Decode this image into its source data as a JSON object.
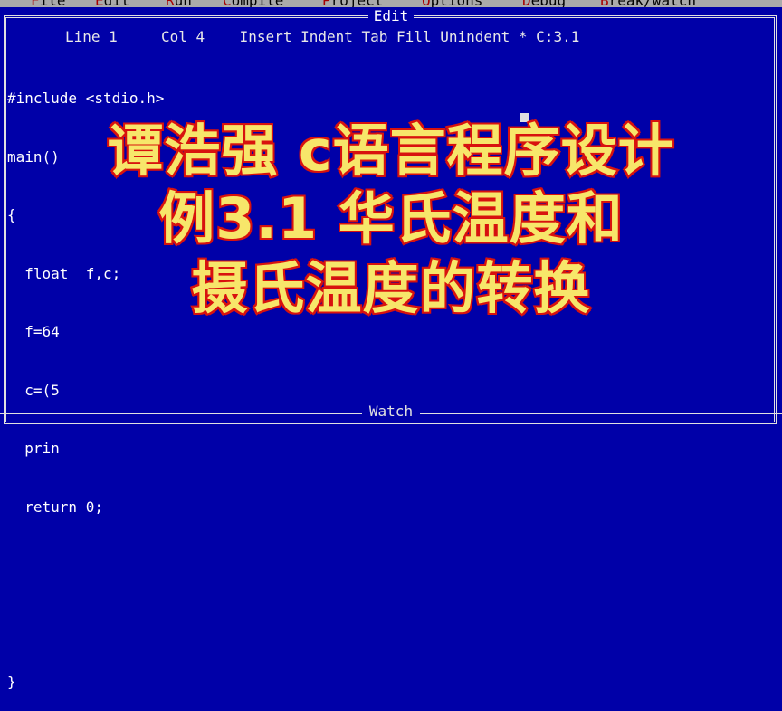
{
  "menu": {
    "items": [
      {
        "label": "File",
        "hot": "F",
        "rest": "ile"
      },
      {
        "label": "Edit",
        "hot": "E",
        "rest": "dit"
      },
      {
        "label": "Run",
        "hot": "R",
        "rest": "un"
      },
      {
        "label": "Compile",
        "hot": "C",
        "rest": "ompile"
      },
      {
        "label": "Project",
        "hot": "P",
        "rest": "roject"
      },
      {
        "label": "Options",
        "hot": "O",
        "rest": "ptions"
      },
      {
        "label": "Debug",
        "hot": "D",
        "rest": "ebug"
      },
      {
        "label": "Break/watch",
        "hot": "B",
        "rest": "reak/watch"
      }
    ]
  },
  "edit_window": {
    "title": "Edit",
    "status": "Line 1     Col 4    Insert Indent Tab Fill Unindent * C:3.1"
  },
  "code": {
    "lines": [
      "#include <stdio.h>",
      "main()",
      "{",
      "  float  f,c;",
      "  f=64",
      "  c=(5",
      "  prin",
      "  return 0;",
      "",
      "",
      "}"
    ]
  },
  "watch_window": {
    "title": "Watch"
  },
  "overlay": {
    "line1": "谭浩强 c语言程序设计",
    "line2": "例3.1 华氏温度和",
    "line3": "摄氏温度的转换"
  },
  "colors": {
    "background": "#0000a8",
    "menubar": "#aaaaaa",
    "overlay_fill": "#f7e66a",
    "overlay_stroke": "#d8130f"
  }
}
